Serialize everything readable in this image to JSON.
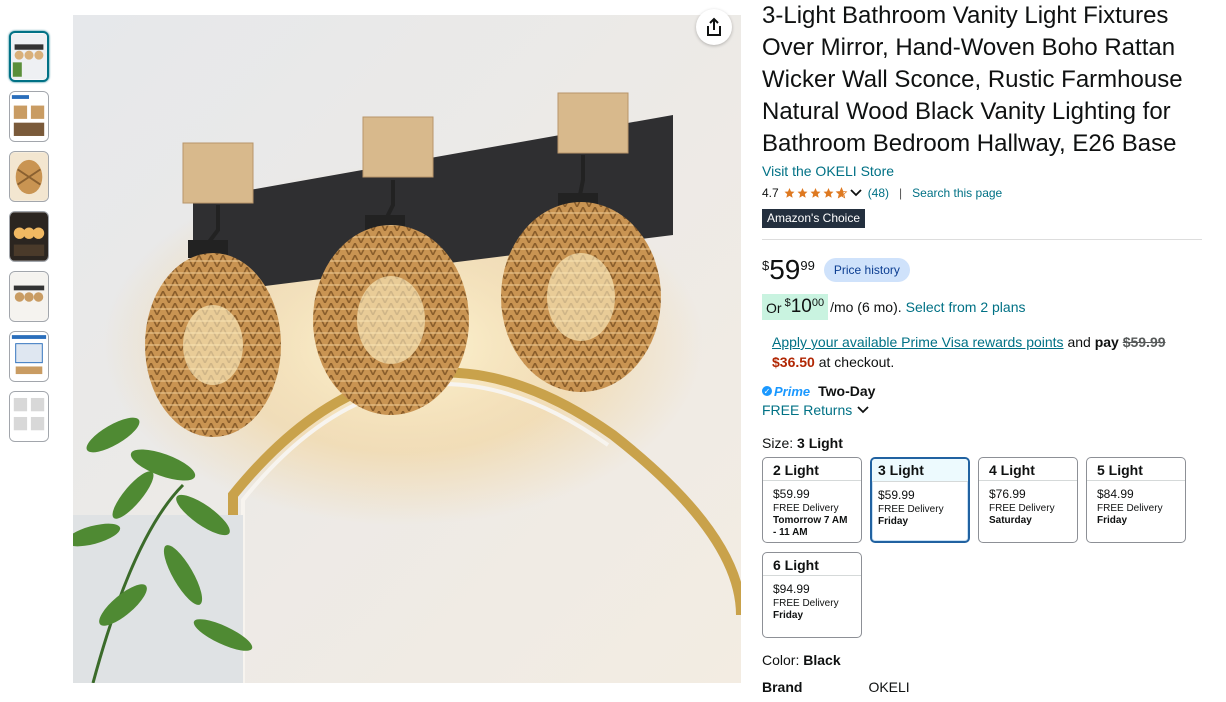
{
  "product": {
    "title": "3-Light Bathroom Vanity Light Fixtures Over Mirror, Hand-Woven Boho Rattan Wicker Wall Sconce, Rustic Farmhouse Natural Wood Black Vanity Lighting for Bathroom Bedroom Hallway, E26 Base",
    "store_link": "Visit the OKELI Store",
    "rating": "4.7",
    "rating_value": 4.7,
    "rating_count": "(48)",
    "separator": "|",
    "search_link": "Search this page",
    "badge_prefix": "Amazon's",
    "badge_suffix": "Choice"
  },
  "price": {
    "symbol": "$",
    "whole": "59",
    "fraction": "99",
    "history_label": "Price history"
  },
  "monthly": {
    "or_label": "Or",
    "symbol": "$",
    "whole": "10",
    "fraction": "00",
    "term": "/mo (6 mo).",
    "plans_link": "Select from 2 plans"
  },
  "visa": {
    "link_text": "Apply your available Prime Visa rewards points",
    "and_text": "and",
    "pay_text": "pay",
    "original_price": "$59.99",
    "new_price": "$36.50",
    "checkout_text": "at checkout."
  },
  "delivery": {
    "prime_label": "Prime",
    "two_day": "Two-Day",
    "returns": "FREE Returns"
  },
  "size": {
    "label": "Size:",
    "selected": "3 Light",
    "options": [
      {
        "name": "2 Light",
        "price": "$59.99",
        "delivery": "FREE Delivery",
        "date": "Tomorrow 7 AM - 11 AM"
      },
      {
        "name": "3 Light",
        "price": "$59.99",
        "delivery": "FREE Delivery",
        "date": "Friday"
      },
      {
        "name": "4 Light",
        "price": "$76.99",
        "delivery": "FREE Delivery",
        "date": "Saturday"
      },
      {
        "name": "5 Light",
        "price": "$84.99",
        "delivery": "FREE Delivery",
        "date": "Friday"
      },
      {
        "name": "6 Light",
        "price": "$94.99",
        "delivery": "FREE Delivery",
        "date": "Friday"
      }
    ]
  },
  "color": {
    "label": "Color:",
    "value": "Black"
  },
  "brand": {
    "label": "Brand",
    "value": "OKELI"
  },
  "icons": {
    "share": "share-icon",
    "star": "star-icon",
    "chevron": "chevron-down-icon",
    "prime_check": "check-icon"
  },
  "colors": {
    "link": "#007185",
    "star": "#de7921",
    "price_red": "#b12704",
    "selected_border": "#2162a1",
    "badge_bg": "#232f3e",
    "badge_accent": "#ff9900"
  }
}
